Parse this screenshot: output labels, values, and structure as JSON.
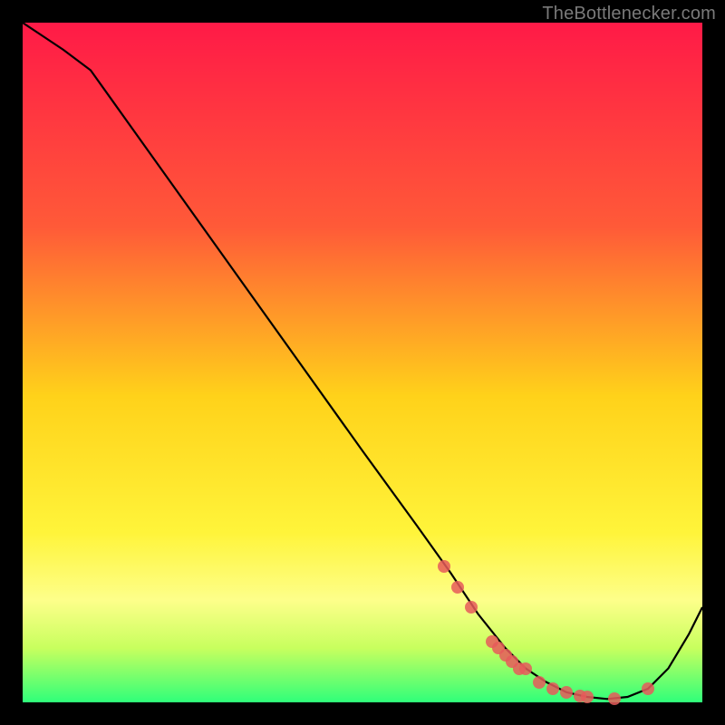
{
  "attribution": "TheBottlenecker.com",
  "chart_data": {
    "type": "line",
    "title": "",
    "xlabel": "",
    "ylabel": "",
    "xlim": [
      0,
      100
    ],
    "ylim": [
      0,
      100
    ],
    "gradient_stops": [
      {
        "pct": 0,
        "color": "#ff1a47"
      },
      {
        "pct": 30,
        "color": "#ff5a38"
      },
      {
        "pct": 55,
        "color": "#ffd21a"
      },
      {
        "pct": 75,
        "color": "#fff43a"
      },
      {
        "pct": 85,
        "color": "#fdff8a"
      },
      {
        "pct": 92,
        "color": "#c8ff5e"
      },
      {
        "pct": 100,
        "color": "#2fff7a"
      }
    ],
    "series": [
      {
        "name": "curve",
        "x": [
          0,
          3,
          6,
          10,
          20,
          30,
          40,
          50,
          58,
          63,
          67,
          71,
          74,
          77,
          80,
          83,
          86,
          89,
          92,
          95,
          98,
          100
        ],
        "values": [
          100,
          98,
          96,
          93,
          79,
          65,
          51,
          37,
          26,
          19,
          13,
          8,
          5,
          3,
          1.5,
          0.8,
          0.5,
          0.8,
          2,
          5,
          10,
          14
        ]
      }
    ],
    "markers": {
      "name": "highlight-points",
      "color": "#e65a5a",
      "x": [
        62,
        64,
        66,
        69,
        70,
        71,
        72,
        73,
        74,
        76,
        78,
        80,
        82,
        83,
        87,
        92
      ],
      "values": [
        20,
        17,
        14,
        9,
        8,
        7,
        6,
        5,
        5,
        3,
        2,
        1.5,
        1,
        0.8,
        0.6,
        2
      ]
    }
  }
}
